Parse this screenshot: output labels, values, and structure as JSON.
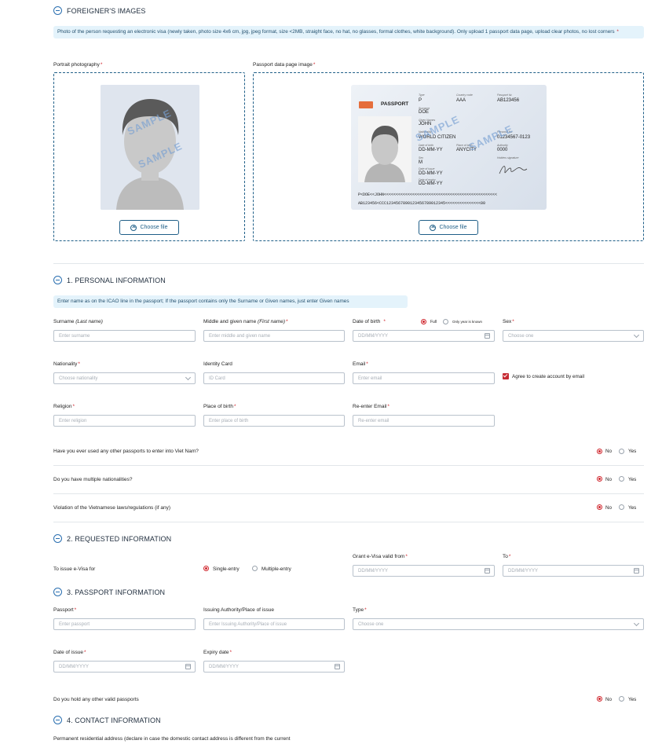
{
  "images": {
    "title": "FOREIGNER'S IMAGES",
    "note": "Photo of the person requesting an electronic visa (newly taken, photo size 4x6 cm, jpg, jpeg format, size <2MB, straight face, no hat, no glasses, formal clothes, white background). Only upload 1 passport data page, upload clear photos, no lost corners",
    "note_req": "*",
    "portrait_label": "Portrait photography",
    "passport_label": "Passport data page image",
    "choose_file": "Choose file",
    "watermark": "SAMPLE",
    "passport_sample": {
      "header": "PASSPORT",
      "type_label": "Type",
      "type": "P",
      "country_label": "Country code",
      "country": "AAA",
      "number_label": "Passport №",
      "number": "AB123456",
      "surname_label": "Surname",
      "surname": "DOE",
      "given_label": "Given Names",
      "given": "JOHN",
      "nationality_label": "Nationality",
      "nationality": "WORLD CITIZEN",
      "dob_label": "Date of birth",
      "dob": "DD-MM-YY",
      "pob_label": "Place of birth",
      "pob": "ANYCITY",
      "personal_no": "01234567-0123",
      "personal_label": "Personal No",
      "sex_label": "Sex",
      "sex": "M",
      "authority_label": "Authority",
      "authority": "0000",
      "signature_label": "Holders signature",
      "issue_label": "Date of issue",
      "issue": "DD-MM-YY",
      "expiry_label": "Date of expiry",
      "expiry": "DD-MM-YY",
      "mrz1": "P<DOE<<JOHN<<<<<<<<<<<<<<<<<<<<<<<<<<<<<<<<<<<<<<<<<<<<<<<<",
      "mrz2": "AB123456<CCC1234567890123456789012345<<<<<<<<<<<<<<<00"
    }
  },
  "personal": {
    "title": "1. PERSONAL INFORMATION",
    "note": "Enter name as on the ICAO line in the passport; If the passport contains only the Surname or Given names, just enter Given names",
    "surname_label": "Surname",
    "surname_italic": "(Last name)",
    "surname_ph": "Enter surname",
    "given_label": "Middle and given name",
    "given_italic": "(First name)",
    "given_ph": "Enter middle and given name",
    "dob_label": "Date of birth",
    "dob_full": "Full",
    "dob_year": "Only year is known",
    "dob_ph": "DD/MM/YYYY",
    "sex_label": "Sex",
    "sex_ph": "Choose one",
    "nationality_label": "Nationality",
    "nationality_ph": "Choose nationality",
    "idcard_label": "Identity Card",
    "idcard_ph": "ID Card",
    "email_label": "Email",
    "email_ph": "Enter email",
    "agree_label": "Agree to create account by email",
    "religion_label": "Religion",
    "religion_ph": "Enter religion",
    "pob_label": "Place of birth",
    "pob_ph": "Enter place of birth",
    "reemail_label": "Re-enter Email",
    "reemail_ph": "Re-enter email",
    "q1": "Have you ever used any other passports to enter into Viet Nam?",
    "q2": "Do you have multiple nationalities?",
    "q3": "Violation of the Vietnamese laws/regulations (if any)",
    "no": "No",
    "yes": "Yes",
    "req": "*"
  },
  "requested": {
    "title": "2. REQUESTED INFORMATION",
    "issue_label": "To issue e-Visa for",
    "single": "Single-entry",
    "multiple": "Multiple-entry",
    "valid_from_label": "Grant e-Visa valid from",
    "to_label": "To",
    "date_ph": "DD/MM/YYYY"
  },
  "passport": {
    "title": "3. PASSPORT INFORMATION",
    "passport_label": "Passport",
    "passport_ph": "Enter passport",
    "authority_label": "Issuing Authority/Place of issue",
    "authority_ph": "Enter Issuing Authority/Place of issue",
    "type_label": "Type",
    "type_ph": "Choose one",
    "issue_label": "Date of issue",
    "expiry_label": "Expiry date",
    "date_ph": "DD/MM/YYYY",
    "other_q": "Do you hold any other valid passports",
    "no": "No",
    "yes": "Yes"
  },
  "contact": {
    "title": "4. CONTACT INFORMATION",
    "address_label": "Permanent residential address (declare in case the domestic contact address is different from the current"
  }
}
